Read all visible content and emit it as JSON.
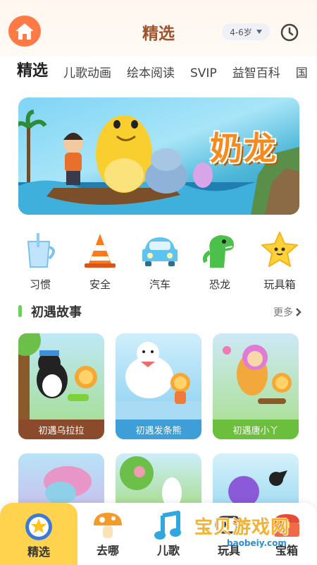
{
  "header": {
    "title": "精选",
    "age_selector": "4-6岁",
    "home_icon": "home-icon",
    "history_icon": "clock-icon"
  },
  "tabs": [
    {
      "label": "精选",
      "active": true
    },
    {
      "label": "儿歌动画",
      "active": false
    },
    {
      "label": "绘本阅读",
      "active": false
    },
    {
      "label": "SVIP",
      "active": false
    },
    {
      "label": "益智百科",
      "active": false
    },
    {
      "label": "国",
      "active": false
    }
  ],
  "banner": {
    "title": "奶龙"
  },
  "categories": [
    {
      "label": "习惯",
      "icon": "cup-icon"
    },
    {
      "label": "安全",
      "icon": "traffic-cone-icon"
    },
    {
      "label": "汽车",
      "icon": "car-icon"
    },
    {
      "label": "恐龙",
      "icon": "dinosaur-icon"
    },
    {
      "label": "玩具箱",
      "icon": "star-toy-icon"
    }
  ],
  "section": {
    "title": "初遇故事",
    "more": "更多"
  },
  "cards": [
    {
      "label": "初遇乌拉拉",
      "label_color": "#8b4a2c"
    },
    {
      "label": "初遇发条熊",
      "label_color": "#3e9fd8"
    },
    {
      "label": "初遇唐小丫",
      "label_color": "#6cbf3c"
    }
  ],
  "bottom_nav": [
    {
      "label": "精选",
      "icon": "star-badge-icon",
      "active": true
    },
    {
      "label": "去哪",
      "icon": "mushroom-icon",
      "active": false
    },
    {
      "label": "儿歌",
      "icon": "music-note-icon",
      "active": false
    },
    {
      "label": "玩具",
      "icon": "gamepad-icon",
      "active": false
    },
    {
      "label": "宝箱",
      "icon": "treasure-box-icon",
      "active": false
    }
  ],
  "watermark": {
    "text": "宝贝游戏网",
    "url": "baobeiy.com"
  },
  "colors": {
    "accent": "#ffd34e",
    "home": "#ff7a45",
    "tab_underline": "#f7c13a",
    "section_bar": "#6ccf5c"
  }
}
